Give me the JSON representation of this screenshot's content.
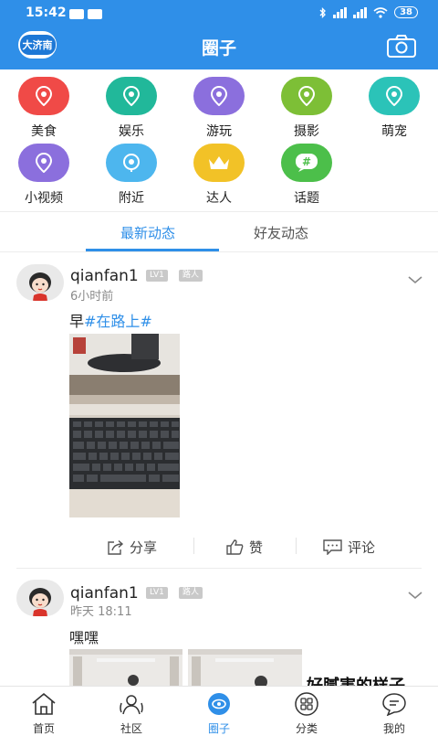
{
  "status_bar": {
    "time": "15:42",
    "battery": "38"
  },
  "header": {
    "title": "圈子",
    "logo_text": "大济南"
  },
  "categories": [
    {
      "label": "美食",
      "color": "#f04a47",
      "icon": "location-pin-icon"
    },
    {
      "label": "娱乐",
      "color": "#21b89a",
      "icon": "location-pin-icon"
    },
    {
      "label": "游玩",
      "color": "#8b6fdd",
      "icon": "location-pin-icon"
    },
    {
      "label": "摄影",
      "color": "#7dbf36",
      "icon": "location-pin-icon"
    },
    {
      "label": "萌宠",
      "color": "#2bc3b8",
      "icon": "location-pin-icon"
    },
    {
      "label": "小视频",
      "color": "#8b6fdd",
      "icon": "location-pin-icon"
    },
    {
      "label": "附近",
      "color": "#4db6ee",
      "icon": "target-pin-icon"
    },
    {
      "label": "达人",
      "color": "#f2c227",
      "icon": "crown-icon"
    },
    {
      "label": "话题",
      "color": "#4cbf4a",
      "icon": "hashtag-icon"
    }
  ],
  "tabs": [
    {
      "label": "最新动态",
      "active": true
    },
    {
      "label": "好友动态",
      "active": false
    }
  ],
  "posts": [
    {
      "username": "qianfan1",
      "level": "LV1",
      "role": "路人",
      "time": "6小时前",
      "text": "早",
      "tag": "#在路上#",
      "actions": {
        "share": "分享",
        "like": "赞",
        "comment": "评论"
      }
    },
    {
      "username": "qianfan1",
      "level": "LV1",
      "role": "路人",
      "time": "昨天 18:11",
      "text": "嘿嘿",
      "image_text": "好腻害的样子"
    }
  ],
  "bottom_nav": [
    {
      "label": "首页",
      "icon": "home-icon"
    },
    {
      "label": "社区",
      "icon": "community-icon"
    },
    {
      "label": "圈子",
      "icon": "circle-eye-icon",
      "active": true
    },
    {
      "label": "分类",
      "icon": "grid-category-icon"
    },
    {
      "label": "我的",
      "icon": "chat-bubble-icon"
    }
  ],
  "colors": {
    "accent": "#2f8fe8",
    "badge": "#c9c9c9"
  }
}
